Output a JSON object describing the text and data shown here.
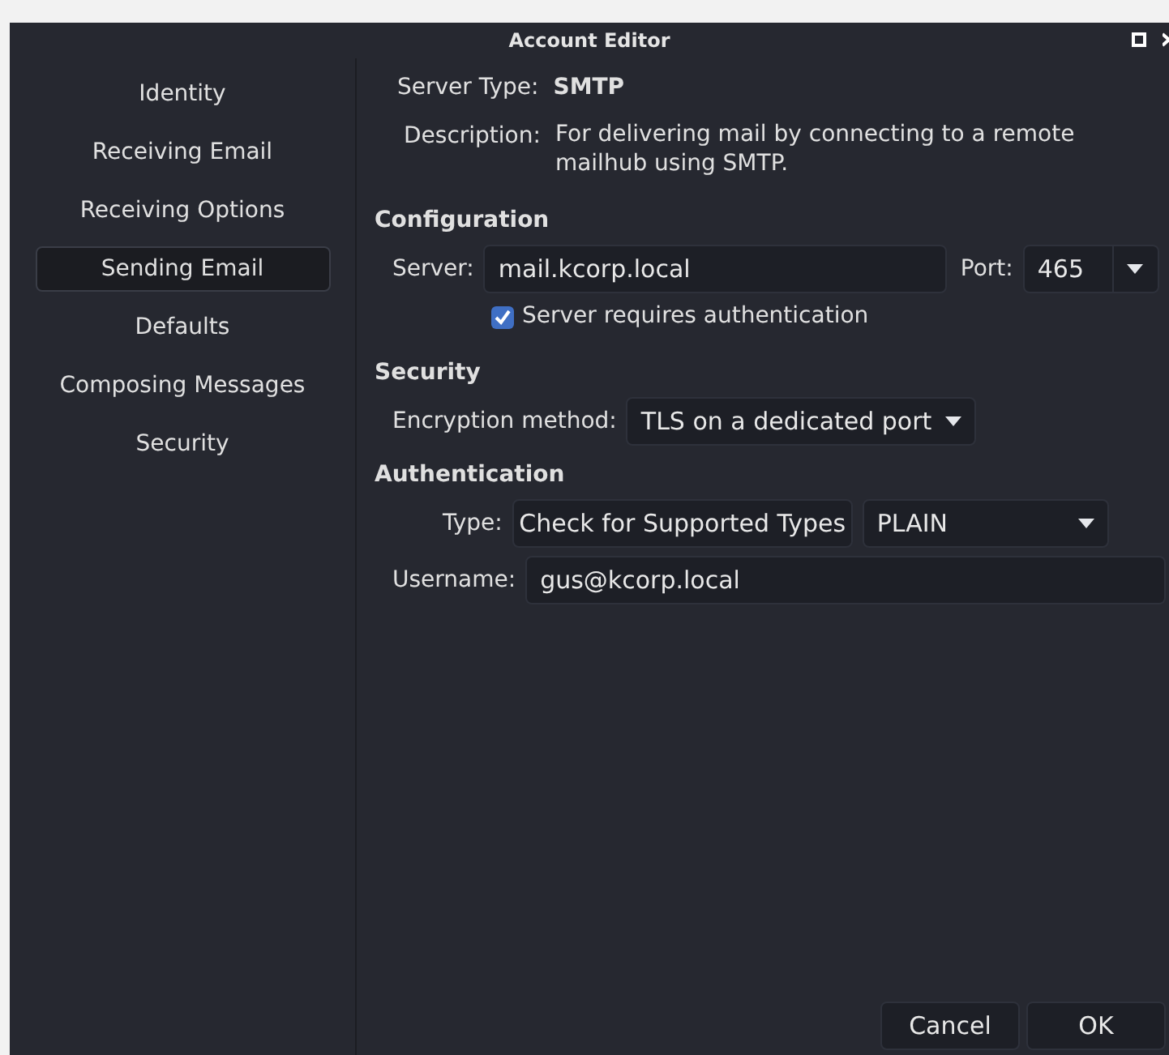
{
  "window": {
    "title": "Account Editor"
  },
  "sidebar": {
    "items": [
      {
        "label": "Identity",
        "selected": false
      },
      {
        "label": "Receiving Email",
        "selected": false
      },
      {
        "label": "Receiving Options",
        "selected": false
      },
      {
        "label": "Sending Email",
        "selected": true
      },
      {
        "label": "Defaults",
        "selected": false
      },
      {
        "label": "Composing Messages",
        "selected": false
      },
      {
        "label": "Security",
        "selected": false
      }
    ]
  },
  "server_type": {
    "label": "Server Type:",
    "value": "SMTP"
  },
  "description": {
    "label": "Description:",
    "value": "For delivering mail by connecting to a remote mailhub using SMTP."
  },
  "configuration": {
    "heading": "Configuration",
    "server_label": "Server:",
    "server_value": "mail.kcorp.local",
    "port_label": "Port:",
    "port_value": "465",
    "requires_auth": {
      "label": "Server requires authentication",
      "checked": true
    }
  },
  "security": {
    "heading": "Security",
    "encryption_label": "Encryption method:",
    "encryption_value": "TLS on a dedicated port"
  },
  "authentication": {
    "heading": "Authentication",
    "type_label": "Type:",
    "check_button": "Check for Supported Types",
    "type_value": "PLAIN",
    "username_label": "Username:",
    "username_value": "gus@kcorp.local"
  },
  "buttons": [
    "Cancel",
    "OK"
  ]
}
